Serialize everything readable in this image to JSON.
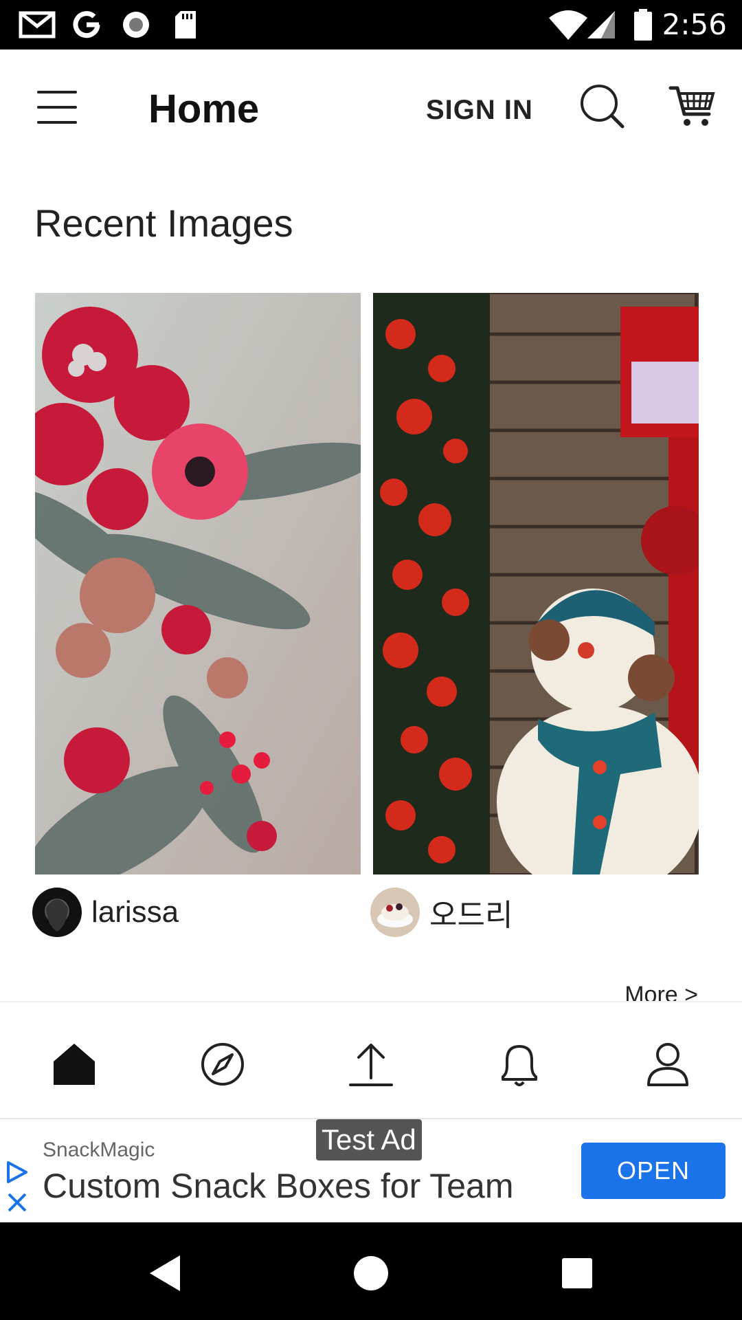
{
  "status_bar": {
    "time": "2:56",
    "left_icons": [
      "gmail-icon",
      "google-icon",
      "record-icon",
      "sd-card-icon"
    ],
    "right_icons": [
      "wifi-icon",
      "signal-icon",
      "battery-icon"
    ]
  },
  "app_bar": {
    "title": "Home",
    "sign_in_label": "SIGN IN",
    "icons": [
      "menu-icon",
      "search-icon",
      "cart-icon"
    ]
  },
  "section": {
    "title": "Recent Images",
    "more_label": "More >",
    "cards": [
      {
        "username": "larissa",
        "image": "christmas-flowers-arrangement"
      },
      {
        "username": "오드리",
        "image": "snowman-christmas-decoration"
      }
    ]
  },
  "bottom_nav": {
    "items": [
      "home-icon",
      "explore-icon",
      "upload-icon",
      "notifications-icon",
      "profile-icon"
    ]
  },
  "ad": {
    "badge": "Test Ad",
    "brand": "SnackMagic",
    "headline": "Custom Snack Boxes for Team",
    "cta": "OPEN",
    "cta_color": "#1a73e8"
  },
  "system_nav": {
    "buttons": [
      "back-icon",
      "home-circle-icon",
      "recents-icon"
    ]
  }
}
